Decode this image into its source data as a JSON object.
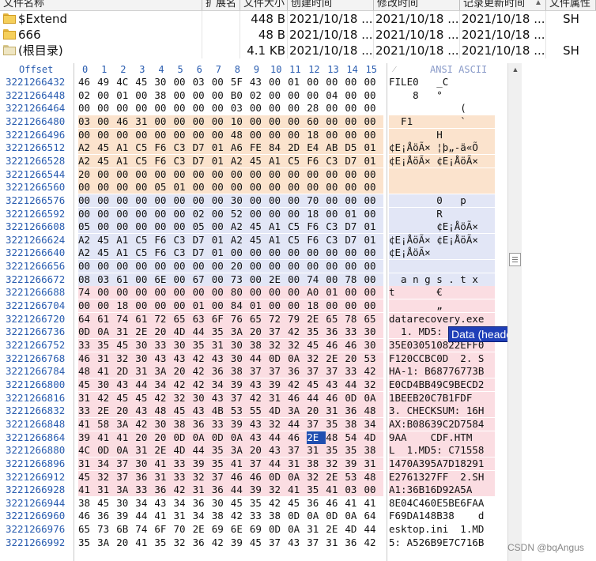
{
  "file_list": {
    "columns": [
      "文件名称",
      "扩展名",
      "文件大小",
      "创建时间",
      "修改时间",
      "记录更新时间",
      "文件属性"
    ],
    "rows": [
      {
        "icon": "folder-icon",
        "name": "$Extend",
        "ext": "",
        "size": "448 B",
        "created": "2021/10/18 ...",
        "modified": "2021/10/18 ...",
        "record_updated": "2021/10/18 ...",
        "attr": "SH"
      },
      {
        "icon": "folder-icon",
        "name": "666",
        "ext": "",
        "size": "48 B",
        "created": "2021/10/18 ...",
        "modified": "2021/10/18 ...",
        "record_updated": "2021/10/18 ...",
        "attr": ""
      },
      {
        "icon": "root-folder-icon",
        "name": "(根目录)",
        "ext": "",
        "size": "4.1 KB",
        "created": "2021/10/18 ...",
        "modified": "2021/10/18 ...",
        "record_updated": "2021/10/18 ...",
        "attr": "SH"
      }
    ]
  },
  "hex_view": {
    "offset_label": "Offset",
    "column_labels": [
      "0",
      "1",
      "2",
      "3",
      "4",
      "5",
      "6",
      "7",
      "8",
      "9",
      "10",
      "11",
      "12",
      "13",
      "14",
      "15"
    ],
    "ascii_label": "ANSI ASCII",
    "tooltip": "Data (header)",
    "rows": [
      {
        "offset": "3221266432",
        "bytes": "46 49 4C 45 30 00 03 00 5F 43 00 01 00 00 00 00",
        "ascii": "FILE0   _C",
        "bg": "a"
      },
      {
        "offset": "3221266448",
        "bytes": "02 00 01 00 38 00 00 00 B0 02 00 00 00 04 00 00",
        "ascii": "    8   °",
        "bg": "a"
      },
      {
        "offset": "3221266464",
        "bytes": "00 00 00 00 00 00 00 00 03 00 00 00 28 00 00 00",
        "ascii": "            (",
        "bg": "a"
      },
      {
        "offset": "3221266480",
        "bytes": "03 00 46 31 00 00 00 00 10 00 00 00 60 00 00 00",
        "ascii": "  F1        `",
        "bg": "peach"
      },
      {
        "offset": "3221266496",
        "bytes": "00 00 00 00 00 00 00 00 48 00 00 00 18 00 00 00",
        "ascii": "        H",
        "bg": "peach"
      },
      {
        "offset": "3221266512",
        "bytes": "A2 45 A1 C5 F6 C3 D7 01 A6 FE 84 2D E4 AB D5 01",
        "ascii": "¢E¡ÅöÃ× ¦þ„-ä«Õ",
        "bg": "peach"
      },
      {
        "offset": "3221266528",
        "bytes": "A2 45 A1 C5 F6 C3 D7 01 A2 45 A1 C5 F6 C3 D7 01",
        "ascii": "¢E¡ÅöÃ× ¢E¡ÅöÃ×",
        "bg": "peach"
      },
      {
        "offset": "3221266544",
        "bytes": "20 00 00 00 00 00 00 00 00 00 00 00 00 00 00 00",
        "ascii": "",
        "bg": "peach"
      },
      {
        "offset": "3221266560",
        "bytes": "00 00 00 00 05 01 00 00 00 00 00 00 00 00 00 00",
        "ascii": "",
        "bg": "peach"
      },
      {
        "offset": "3221266576",
        "bytes": "00 00 00 00 00 00 00 00 30 00 00 00 70 00 00 00",
        "ascii": "        0   p",
        "bg": "blue"
      },
      {
        "offset": "3221266592",
        "bytes": "00 00 00 00 00 00 02 00 52 00 00 00 18 00 01 00",
        "ascii": "        R",
        "bg": "blue"
      },
      {
        "offset": "3221266608",
        "bytes": "05 00 00 00 00 00 05 00 A2 45 A1 C5 F6 C3 D7 01",
        "ascii": "        ¢E¡ÅöÃ×",
        "bg": "blue"
      },
      {
        "offset": "3221266624",
        "bytes": "A2 45 A1 C5 F6 C3 D7 01 A2 45 A1 C5 F6 C3 D7 01",
        "ascii": "¢E¡ÅöÃ× ¢E¡ÅöÃ×",
        "bg": "blue"
      },
      {
        "offset": "3221266640",
        "bytes": "A2 45 A1 C5 F6 C3 D7 01 00 00 00 00 00 00 00 00",
        "ascii": "¢E¡ÅöÃ×",
        "bg": "blue"
      },
      {
        "offset": "3221266656",
        "bytes": "00 00 00 00 00 00 00 00 20 00 00 00 00 00 00 00",
        "ascii": "",
        "bg": "blue"
      },
      {
        "offset": "3221266672",
        "bytes": "08 03 61 00 6E 00 67 00 73 00 2E 00 74 00 78 00",
        "ascii": "  a n g s . t x",
        "bg": "blue"
      },
      {
        "offset": "3221266688",
        "bytes": "74 00 00 00 00 00 00 00 80 00 00 00 A0 01 00 00",
        "ascii": "t       €",
        "bg": "pink"
      },
      {
        "offset": "3221266704",
        "bytes": "00 00 18 00 00 00 01 00 84 01 00 00 18 00 00 00",
        "ascii": "        „",
        "bg": "pink"
      },
      {
        "offset": "3221266720",
        "bytes": "64 61 74 61 72 65 63 6F 76 65 72 79 2E 65 78 65",
        "ascii": "datarecovery.exe",
        "bg": "pink"
      },
      {
        "offset": "3221266736",
        "bytes": "0D 0A 31 2E 20 4D 44 35 3A 20 37 42 35 36 33 30",
        "ascii": "  1. MD5: 7B5630",
        "bg": "pink"
      },
      {
        "offset": "3221266752",
        "bytes": "33 35 45 30 33 30 35 31 30 38 32 32 45 46 46 30",
        "ascii": "35E030510822EFF0",
        "bg": "pink"
      },
      {
        "offset": "3221266768",
        "bytes": "46 31 32 30 43 43 42 43 30 44 0D 0A 32 2E 20 53",
        "ascii": "F120CCBC0D  2. S",
        "bg": "pink"
      },
      {
        "offset": "3221266784",
        "bytes": "48 41 2D 31 3A 20 42 36 38 37 37 36 37 37 33 42",
        "ascii": "HA-1: B68776773B",
        "bg": "pink"
      },
      {
        "offset": "3221266800",
        "bytes": "45 30 43 44 34 42 42 34 39 43 39 42 45 43 44 32",
        "ascii": "E0CD4BB49C9BECD2",
        "bg": "pink"
      },
      {
        "offset": "3221266816",
        "bytes": "31 42 45 45 42 32 30 43 37 42 31 46 44 46 0D 0A",
        "ascii": "1BEEB20C7B1FDF",
        "bg": "pink"
      },
      {
        "offset": "3221266832",
        "bytes": "33 2E 20 43 48 45 43 4B 53 55 4D 3A 20 31 36 48",
        "ascii": "3. CHECKSUM: 16H",
        "bg": "pink"
      },
      {
        "offset": "3221266848",
        "bytes": "41 58 3A 42 30 38 36 33 39 43 32 44 37 35 38 34",
        "ascii": "AX:B08639C2D7584",
        "bg": "pink"
      },
      {
        "offset": "3221266864",
        "bytes": "39 41 41 20 20 0D 0A 0D 0A 43 44 46 2E 48 54 4D",
        "ascii": "9AA    CDF.HTM",
        "bg": "pink"
      },
      {
        "offset": "3221266880",
        "bytes": "4C 0D 0A 31 2E 4D 44 35 3A 20 43 37 31 35 35 38",
        "ascii": "L  1.MD5: C71558",
        "bg": "pink"
      },
      {
        "offset": "3221266896",
        "bytes": "31 34 37 30 41 33 39 35 41 37 44 31 38 32 39 31",
        "ascii": "1470A395A7D18291",
        "bg": "pink"
      },
      {
        "offset": "3221266912",
        "bytes": "45 32 37 36 31 33 32 37 46 46 0D 0A 32 2E 53 48",
        "ascii": "E2761327FF  2.SH",
        "bg": "pink"
      },
      {
        "offset": "3221266928",
        "bytes": "41 31 3A 33 36 42 31 36 44 39 32 41 35 41 03 00",
        "ascii": "A1:36B16D92A5A",
        "bg": "pink"
      },
      {
        "offset": "3221266944",
        "bytes": "38 45 30 34 43 34 36 30 45 35 42 45 36 46 41 41",
        "ascii": "8E04C460E5BE6FAA",
        "bg": "a"
      },
      {
        "offset": "3221266960",
        "bytes": "46 36 39 44 41 31 34 38 42 33 38 0D 0A 0D 0A 64",
        "ascii": "F69DA148B38    d",
        "bg": "a"
      },
      {
        "offset": "3221266976",
        "bytes": "65 73 6B 74 6F 70 2E 69 6E 69 0D 0A 31 2E 4D 44",
        "ascii": "esktop.ini  1.MD",
        "bg": "a"
      },
      {
        "offset": "3221266992",
        "bytes": "35 3A 20 41 35 32 36 42 39 45 37 43 37 31 36 42",
        "ascii": "5: A526B9E7C716B",
        "bg": "a"
      }
    ]
  },
  "watermark": "CSDN @bqAngus",
  "colors": {
    "offset_blue": "#2a5db0",
    "peach": "#fbe3cd",
    "blue": "#e2e6f6",
    "pink": "#fbdde2",
    "selection": "#1f4fb0"
  }
}
